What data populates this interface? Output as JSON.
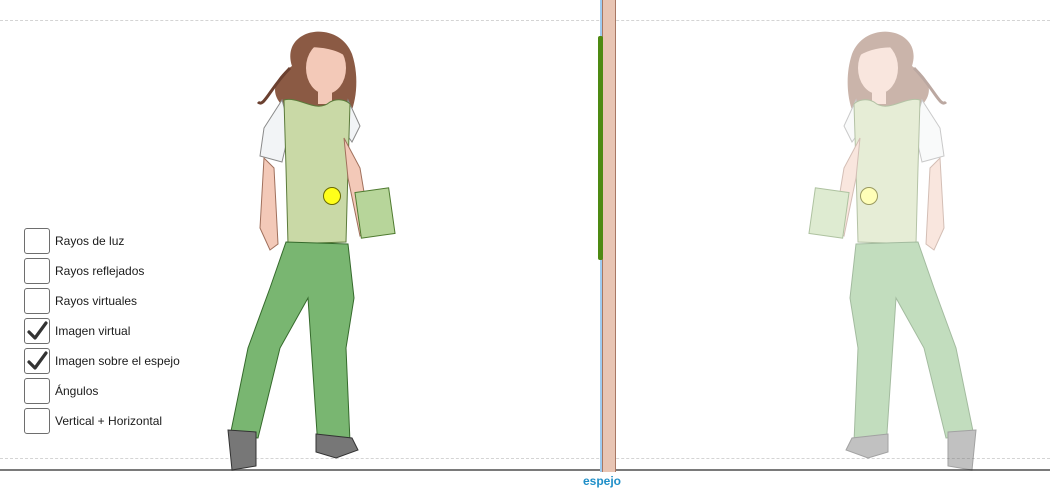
{
  "mirror": {
    "label": "espejo"
  },
  "checkboxes": [
    {
      "label": "Rayos de luz",
      "checked": false
    },
    {
      "label": "Rayos reflejados",
      "checked": false
    },
    {
      "label": "Rayos virtuales",
      "checked": false
    },
    {
      "label": "Imagen virtual",
      "checked": true
    },
    {
      "label": "Imagen sobre el espejo",
      "checked": true
    },
    {
      "label": "Ángulos",
      "checked": false
    },
    {
      "label": "Vertical + Horizontal",
      "checked": false
    }
  ],
  "colors": {
    "mirror_green": "#4e8a12",
    "mirror_line": "#9ecbf0",
    "mirror_body": "#e8c5b4",
    "object_point": "#ffff1a",
    "image_point": "#ffffb8",
    "label_blue": "#1f8fc8"
  },
  "icons": [
    "check-icon"
  ]
}
